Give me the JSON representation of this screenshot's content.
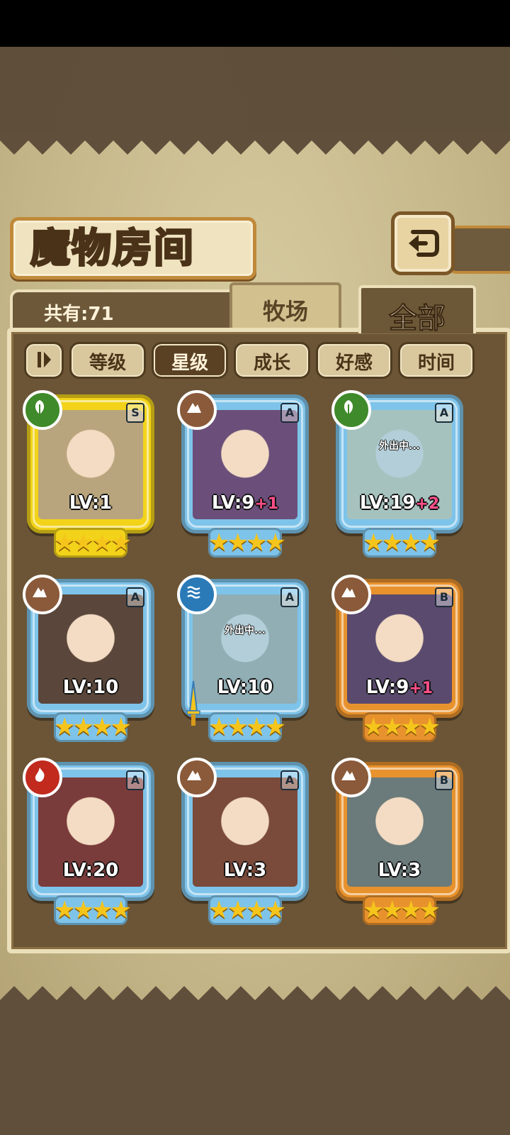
{
  "header": {
    "title": "魔物房间"
  },
  "tabs": {
    "count_label": "共有:71",
    "pasture": "牧场",
    "all": "全部",
    "active": "全部"
  },
  "sort": {
    "buttons": [
      {
        "label": "等级",
        "active": false
      },
      {
        "label": "星级",
        "active": true
      },
      {
        "label": "成长",
        "active": false
      },
      {
        "label": "好感",
        "active": false
      },
      {
        "label": "时间",
        "active": false
      }
    ]
  },
  "cards": [
    {
      "grade": "S",
      "element": "leaf-icon",
      "level": "LV:1",
      "bonus": "",
      "stars": "★★★★",
      "away": "",
      "frame_color": "#f2d31a"
    },
    {
      "grade": "A",
      "element": "mountain-icon",
      "level": "LV:9",
      "bonus": "+1",
      "stars": "★★★★",
      "away": "",
      "frame_color": "#7ec3e9"
    },
    {
      "grade": "A",
      "element": "leaf-icon",
      "level": "LV:19",
      "bonus": "+2",
      "stars": "★★★★",
      "away": "外出中...",
      "frame_color": "#7ec3e9"
    },
    {
      "grade": "A",
      "element": "mountain-icon",
      "level": "LV:10",
      "bonus": "",
      "stars": "★★★★",
      "away": "",
      "frame_color": "#7ec3e9"
    },
    {
      "grade": "A",
      "element": "water-icon",
      "level": "LV:10",
      "bonus": "",
      "stars": "★★★★",
      "away": "外出中...",
      "frame_color": "#7ec3e9"
    },
    {
      "grade": "B",
      "element": "mountain-icon",
      "level": "LV:9",
      "bonus": "+1",
      "stars": "★★★★",
      "away": "",
      "frame_color": "#e8922e"
    },
    {
      "grade": "A",
      "element": "fire-icon",
      "level": "LV:20",
      "bonus": "",
      "stars": "★★★★",
      "away": "",
      "frame_color": "#7ec3e9"
    },
    {
      "grade": "A",
      "element": "mountain-icon",
      "level": "LV:3",
      "bonus": "",
      "stars": "★★★★",
      "away": "",
      "frame_color": "#7ec3e9"
    },
    {
      "grade": "B",
      "element": "mountain-icon",
      "level": "LV:3",
      "bonus": "",
      "stars": "★★★★",
      "away": "",
      "frame_color": "#e8922e"
    }
  ]
}
